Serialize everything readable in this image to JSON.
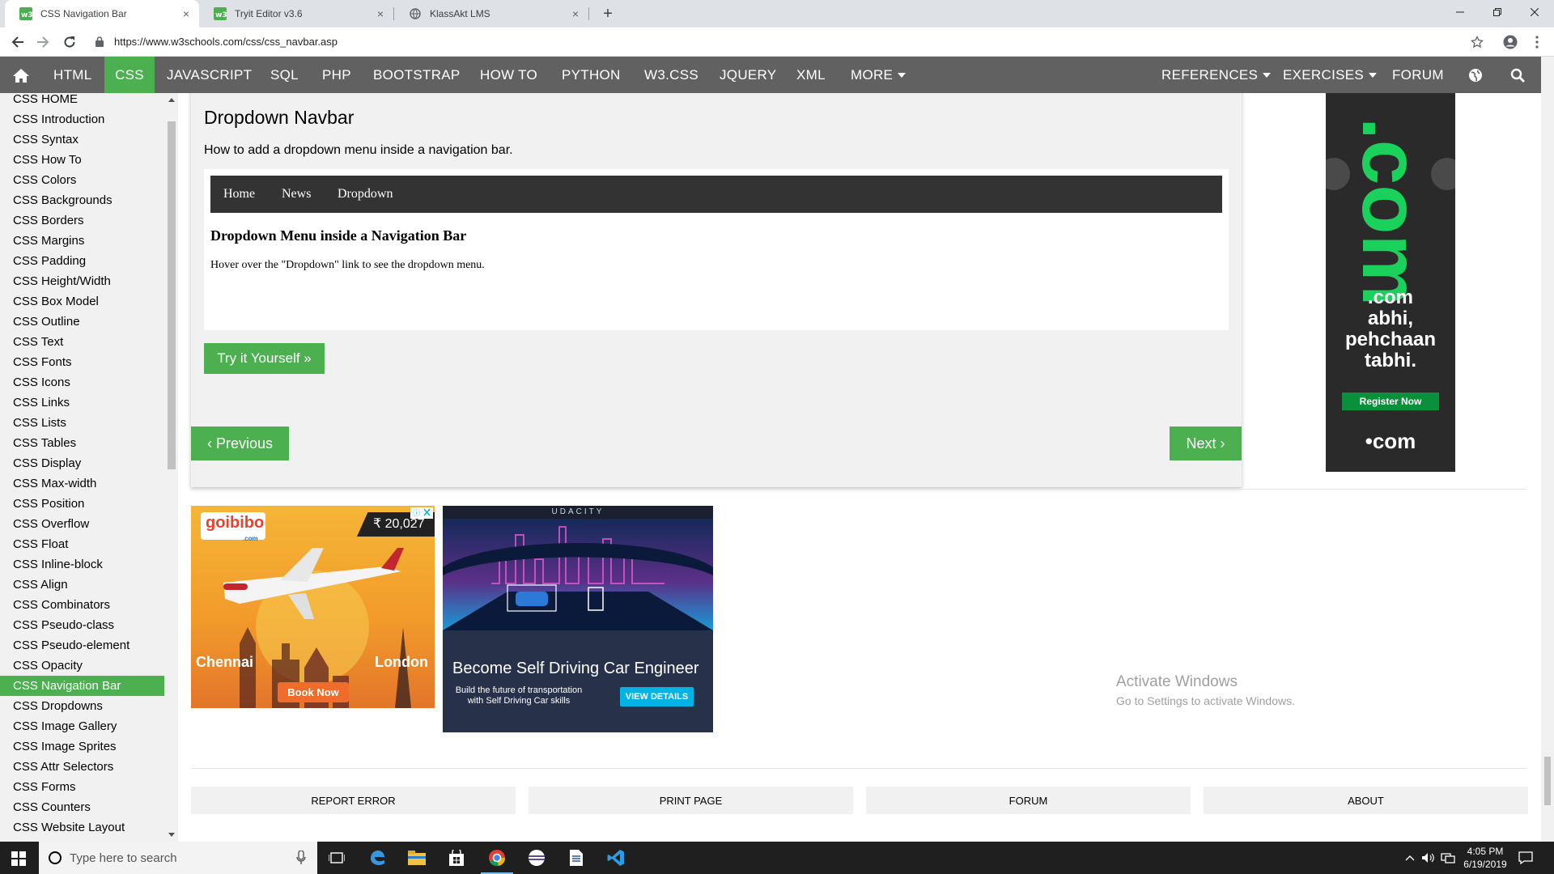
{
  "browser": {
    "tabs": [
      {
        "title": "CSS Navigation Bar",
        "icon": "w3schools-icon",
        "active": true
      },
      {
        "title": "Tryit Editor v3.6",
        "icon": "w3schools-icon",
        "active": false
      },
      {
        "title": "KlassAkt LMS",
        "icon": "globe-icon",
        "active": false
      }
    ],
    "close_glyph": "×",
    "newtab_glyph": "+",
    "url": "https://www.w3schools.com/css/css_navbar.asp"
  },
  "topnav": {
    "items": [
      "HTML",
      "CSS",
      "JAVASCRIPT",
      "SQL",
      "PHP",
      "BOOTSTRAP",
      "HOW TO",
      "PYTHON",
      "W3.CSS",
      "JQUERY",
      "XML",
      "MORE"
    ],
    "active": "CSS",
    "right_items": [
      "REFERENCES",
      "EXERCISES",
      "FORUM"
    ]
  },
  "sidebar": {
    "items": [
      "CSS HOME",
      "CSS Introduction",
      "CSS Syntax",
      "CSS How To",
      "CSS Colors",
      "CSS Backgrounds",
      "CSS Borders",
      "CSS Margins",
      "CSS Padding",
      "CSS Height/Width",
      "CSS Box Model",
      "CSS Outline",
      "CSS Text",
      "CSS Fonts",
      "CSS Icons",
      "CSS Links",
      "CSS Lists",
      "CSS Tables",
      "CSS Display",
      "CSS Max-width",
      "CSS Position",
      "CSS Overflow",
      "CSS Float",
      "CSS Inline-block",
      "CSS Align",
      "CSS Combinators",
      "CSS Pseudo-class",
      "CSS Pseudo-element",
      "CSS Opacity",
      "CSS Navigation Bar",
      "CSS Dropdowns",
      "CSS Image Gallery",
      "CSS Image Sprites",
      "CSS Attr Selectors",
      "CSS Forms",
      "CSS Counters",
      "CSS Website Layout"
    ],
    "active": "CSS Navigation Bar"
  },
  "example": {
    "title": "Dropdown Navbar",
    "description": "How to add a dropdown menu inside a navigation bar.",
    "demo_nav": [
      "Home",
      "News",
      "Dropdown"
    ],
    "demo_heading": "Dropdown Menu inside a Navigation Bar",
    "demo_text": "Hover over the \"Dropdown\" link to see the dropdown menu.",
    "try_button": "Try it Yourself »"
  },
  "pager": {
    "previous": "‹ Previous",
    "next": "Next ›"
  },
  "ads": {
    "goibibo": {
      "logo": "goibibo",
      "logo_sub": ".com",
      "price": "₹ 20,027",
      "from": "Chennai",
      "to": "London",
      "cta": "Book Now"
    },
    "udacity": {
      "brand": "UDACITY",
      "headline": "Become Self Driving Car Engineer",
      "sub": "Build the future of transportation with Self Driving Car skills",
      "cta": "VIEW DETAILS"
    },
    "dotcom": {
      "big": ".com",
      "tagline1": ".com",
      "tagline2": "abhi,",
      "tagline3": "pehchaan",
      "tagline4": "tabhi.",
      "cta": "Register Now",
      "footer": "•com"
    }
  },
  "footer": {
    "buttons": [
      "REPORT ERROR",
      "PRINT PAGE",
      "FORUM",
      "ABOUT"
    ]
  },
  "watermark": {
    "line1": "Activate Windows",
    "line2": "Go to Settings to activate Windows."
  },
  "taskbar": {
    "search_placeholder": "Type here to search",
    "time": "4:05 PM",
    "date": "6/19/2019"
  },
  "colors": {
    "accent": "#4caf50",
    "topnav": "#616161",
    "sidebar": "#f1f1f1",
    "demobar": "#333333"
  }
}
